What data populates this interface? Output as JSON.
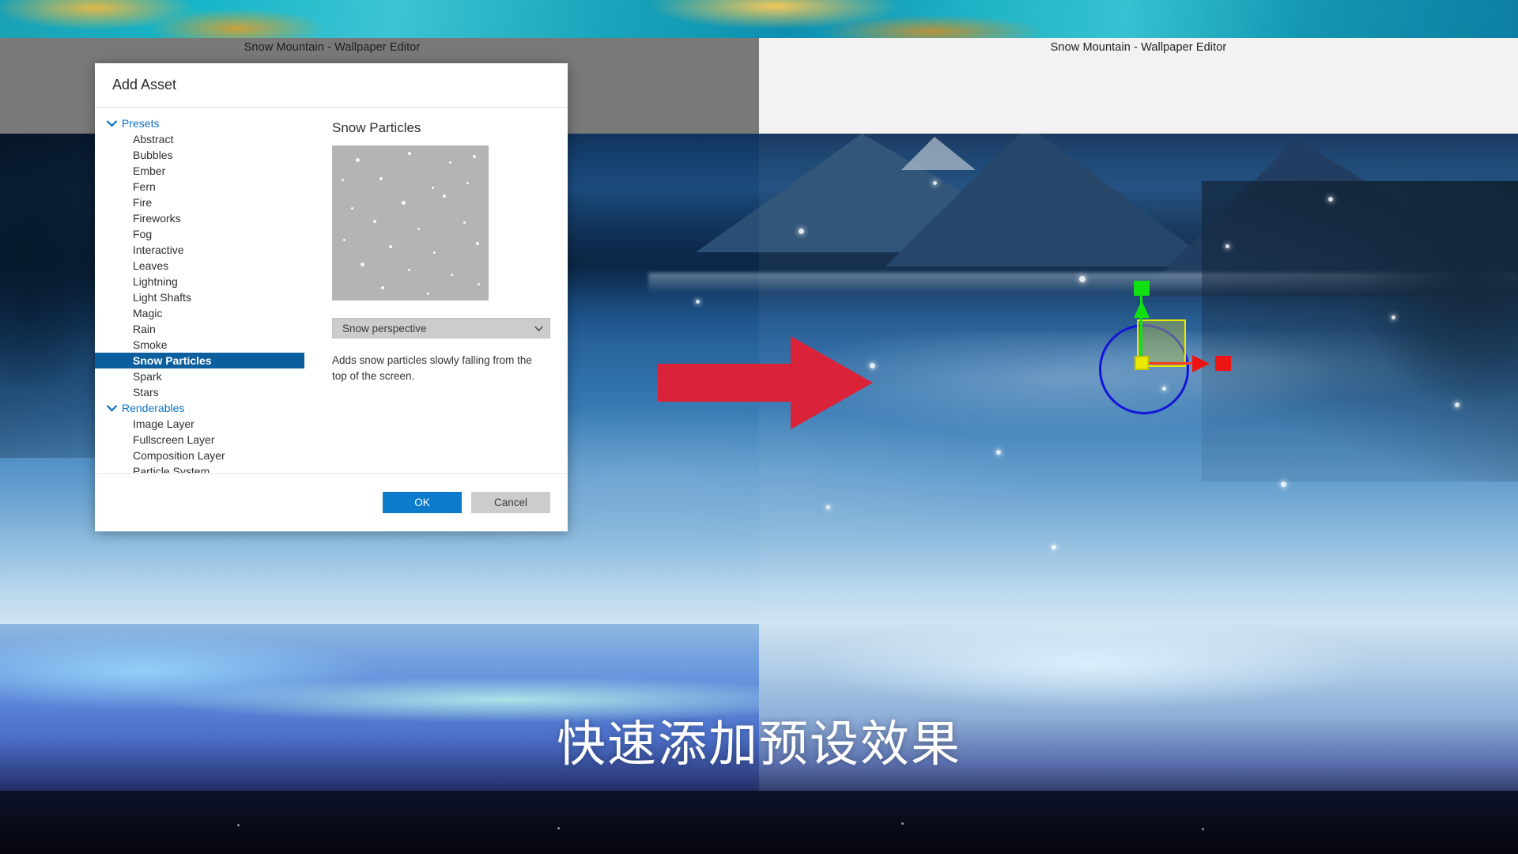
{
  "windows": {
    "left_title": "Snow Mountain - Wallpaper Editor",
    "right_title": "Snow Mountain - Wallpaper Editor"
  },
  "subtitle": "快速添加预设效果",
  "dialog": {
    "title": "Add Asset",
    "groups": [
      {
        "label": "Presets",
        "expanded": true,
        "items": [
          "Abstract",
          "Bubbles",
          "Ember",
          "Fern",
          "Fire",
          "Fireworks",
          "Fog",
          "Interactive",
          "Leaves",
          "Lightning",
          "Light Shafts",
          "Magic",
          "Rain",
          "Smoke",
          "Snow Particles",
          "Spark",
          "Stars"
        ]
      },
      {
        "label": "Renderables",
        "expanded": true,
        "items": [
          "Image Layer",
          "Fullscreen Layer",
          "Composition Layer",
          "Particle System"
        ]
      }
    ],
    "selected_item": "Snow Particles",
    "detail": {
      "title": "Snow Particles",
      "preview_label": "snow-particles-preview",
      "combo_value": "Snow perspective",
      "description": "Adds snow particles slowly falling from the top of the screen."
    },
    "footer": {
      "ok_label": "OK",
      "cancel_label": "Cancel"
    }
  },
  "annotation": {
    "arrow_name": "red-right-arrow",
    "arrow_color": "#da2338"
  },
  "gizmo": {
    "x_axis_color": "#ef1414",
    "y_axis_color": "#13e013",
    "ring_color": "#1414d8",
    "plane_color": "#e8e800"
  },
  "colors": {
    "accent": "#0c7bcb",
    "selection": "#0b5f9e",
    "link": "#0c70c5"
  }
}
